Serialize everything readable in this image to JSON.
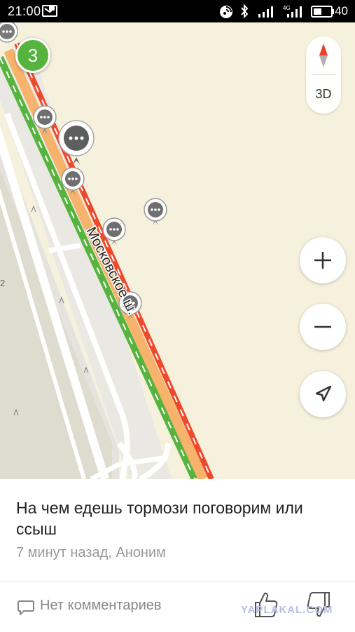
{
  "status_bar": {
    "time": "21:00",
    "network_label": "4G",
    "battery": "40"
  },
  "map": {
    "street_label": "Московское ш.",
    "edge_label": "2",
    "traffic_level": "3",
    "view_mode_label": "3D"
  },
  "colors": {
    "map_background": "#f6f1dd",
    "traffic_green": "#56b43e",
    "traffic_red": "#f0482a",
    "traffic_orange": "#f7b26c"
  },
  "post": {
    "title": "На чем едешь тормози поговорим или ссыш",
    "meta": "7 минут назад, Аноним",
    "comments_label": "Нет комментариев"
  },
  "watermark": "YAPLAKAL.COM"
}
